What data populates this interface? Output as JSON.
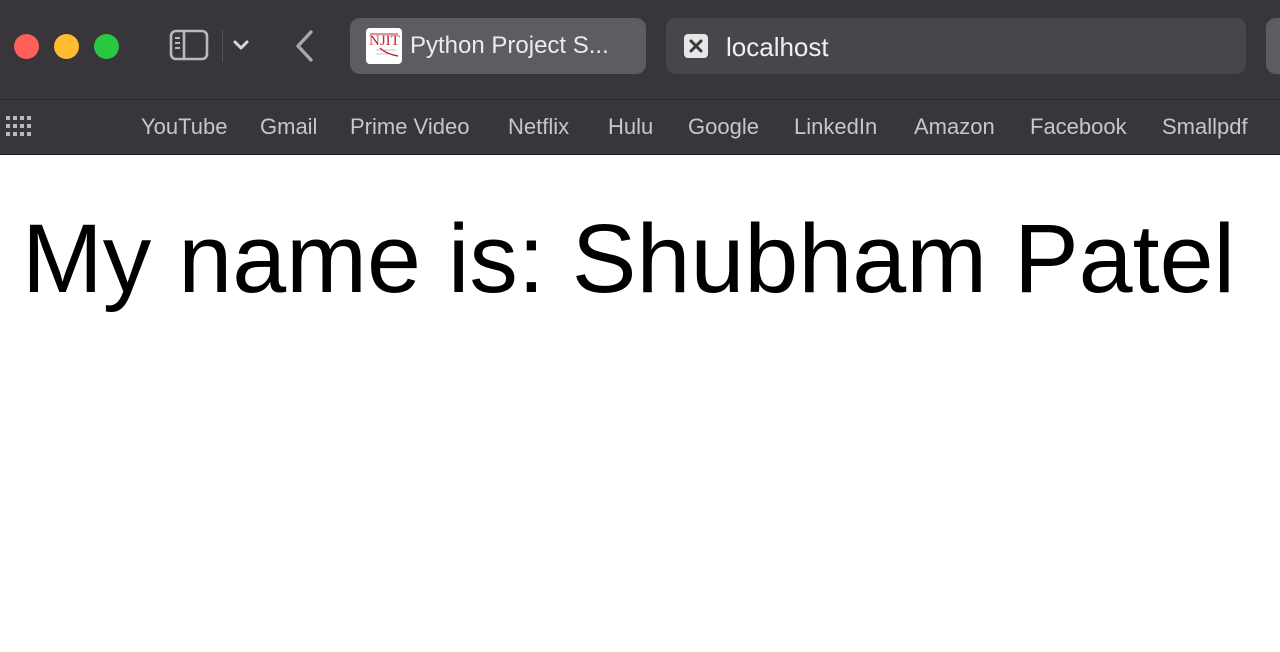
{
  "window": {
    "tab": {
      "title": "Python Project S...",
      "favicon": "njit-logo"
    },
    "address_bar": {
      "value": "localhost"
    }
  },
  "bookmarks": [
    "YouTube",
    "Gmail",
    "Prime Video",
    "Netflix",
    "Hulu",
    "Google",
    "LinkedIn",
    "Amazon",
    "Facebook",
    "Smallpdf"
  ],
  "page": {
    "heading": "My name is: Shubham Patel"
  },
  "icons": {
    "close": "close-window-icon",
    "minimize": "minimize-window-icon",
    "maximize": "maximize-window-icon",
    "sidebar": "sidebar-icon",
    "chevron": "chevron-down-icon",
    "back": "back-arrow-icon",
    "favorites": "grid-icon",
    "site": "close-x-icon"
  },
  "colors": {
    "toolbar": "#38363b",
    "tab": "#5e5c62",
    "address_bar": "#48464c"
  }
}
